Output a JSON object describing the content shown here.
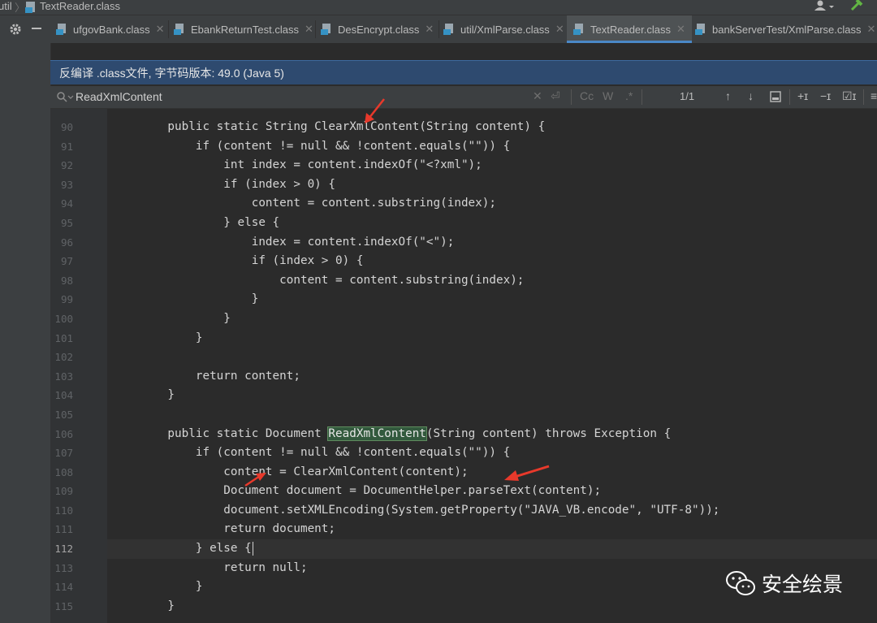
{
  "navbar": {
    "breadcrumb_util": "util",
    "breadcrumb_file": "TextReader.class"
  },
  "tabs": [
    {
      "label": "ufgovBank.class",
      "active": false
    },
    {
      "label": "EbankReturnTest.class",
      "active": false
    },
    {
      "label": "DesEncrypt.class",
      "active": false
    },
    {
      "label": "util/XmlParse.class",
      "active": false
    },
    {
      "label": "TextReader.class",
      "active": true
    },
    {
      "label": "bankServerTest/XmlParse.class",
      "active": false
    }
  ],
  "banner": {
    "text": "反编译 .class文件, 字节码版本: 49.0 (Java 5)"
  },
  "search": {
    "value": "ReadXmlContent",
    "case_toggle": "Cc",
    "word_toggle": "W",
    "regex_toggle": ".*",
    "match_count": "1/1"
  },
  "editor": {
    "current_line": "112",
    "line_numbers": [
      "90",
      "91",
      "92",
      "93",
      "94",
      "95",
      "96",
      "97",
      "98",
      "99",
      "100",
      "101",
      "102",
      "103",
      "104",
      "105",
      "106",
      "107",
      "108",
      "109",
      "110",
      "111",
      "112",
      "113",
      "114",
      "115"
    ],
    "lines": [
      "    public static String ClearXmlContent(String content) {",
      "        if (content != null && !content.equals(\"\")) {",
      "            int index = content.indexOf(\"<?xml\");",
      "            if (index > 0) {",
      "                content = content.substring(index);",
      "            } else {",
      "                index = content.indexOf(\"<\");",
      "                if (index > 0) {",
      "                    content = content.substring(index);",
      "                }",
      "            }",
      "        }",
      "",
      "        return content;",
      "    }",
      "",
      "    public static Document ",
      "        if (content != null && !content.equals(\"\")) {",
      "            content = ClearXmlContent(content);",
      "            Document document = DocumentHelper.parseText(content);",
      "            document.setXMLEncoding(System.getProperty(\"JAVA_VB.encode\", \"UTF-8\"));",
      "            return document;",
      "        } else {",
      "            return null;",
      "        }",
      "    }"
    ],
    "highlight_word": "ReadXmlContent",
    "line106_suffix": "(String content) throws Exception {"
  },
  "watermark": {
    "text": "安全绘景"
  },
  "colors": {
    "background": "#2b2b2b",
    "banner": "#2e4a6f",
    "tab_active_underline": "#4a88c7",
    "annotation_arrow": "#e8392b",
    "match_highlight": "#32593d"
  },
  "icons": [
    "file-class-icon",
    "user-icon",
    "hammer-icon",
    "gear-icon",
    "minus-icon",
    "search-icon",
    "clear-icon",
    "arrow-up-icon",
    "arrow-down-icon",
    "select-all-icon",
    "add-selection-icon",
    "remove-selection-icon",
    "toggle-selection-icon",
    "more-icon",
    "wechat-icon"
  ]
}
